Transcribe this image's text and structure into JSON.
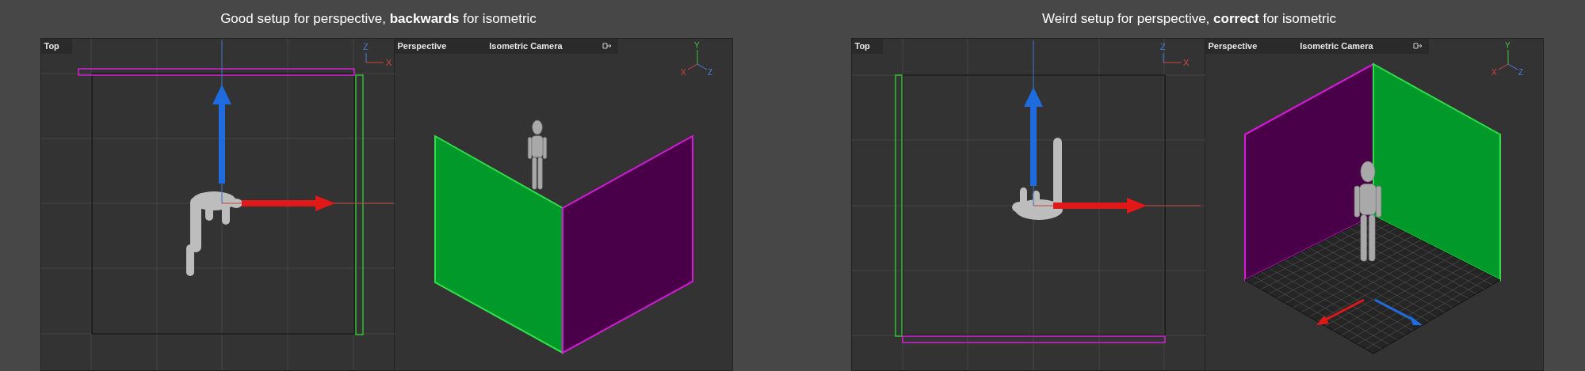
{
  "panels": [
    {
      "caption": "Good setup for perspective, **backwards** for isometric",
      "kind": "backwards",
      "top_view": {
        "label": "Top",
        "axes": [
          "Z",
          "X"
        ]
      },
      "perspective_view": {
        "label": "Perspective",
        "camera": "Isometric Camera",
        "axes": [
          "Y",
          "X",
          "Z"
        ]
      }
    },
    {
      "caption": "Weird setup for perspective, **correct** for isometric",
      "kind": "correct",
      "top_view": {
        "label": "Top",
        "axes": [
          "Z",
          "X"
        ]
      },
      "perspective_view": {
        "label": "Perspective",
        "camera": "Isometric Camera",
        "axes": [
          "Y",
          "X",
          "Z"
        ]
      }
    }
  ]
}
